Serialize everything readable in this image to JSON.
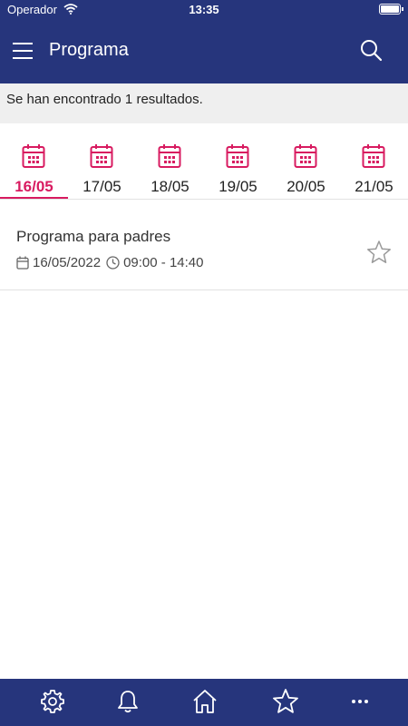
{
  "status_bar": {
    "carrier": "Operador",
    "time": "13:35"
  },
  "app_bar": {
    "title": "Programa"
  },
  "results": {
    "text": "Se han encontrado 1 resultados."
  },
  "date_tabs": [
    {
      "label": "16/05",
      "active": true
    },
    {
      "label": "17/05",
      "active": false
    },
    {
      "label": "18/05",
      "active": false
    },
    {
      "label": "19/05",
      "active": false
    },
    {
      "label": "20/05",
      "active": false
    },
    {
      "label": "21/05",
      "active": false
    }
  ],
  "events": [
    {
      "title": "Programa para padres",
      "date": "16/05/2022",
      "time": "09:00 - 14:40",
      "favorite": false
    }
  ],
  "bottom_nav": {
    "items": [
      "settings-icon",
      "bell-icon",
      "home-icon",
      "star-icon",
      "more-icon"
    ]
  },
  "colors": {
    "primary": "#26357c",
    "accent": "#d81b60"
  }
}
